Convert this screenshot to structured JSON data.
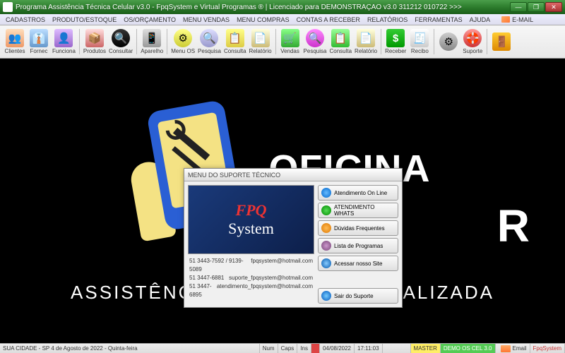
{
  "window": {
    "title": "Programa Assistência Técnica Celular v3.0 - FpqSystem e Virtual Programas ® | Licenciado para  DEMONSTRAÇÃO v3.0 311212 010722 >>>"
  },
  "menu": {
    "items": [
      "CADASTROS",
      "PRODUTO/ESTOQUE",
      "OS/ORÇAMENTO",
      "MENU VENDAS",
      "MENU COMPRAS",
      "CONTAS A RECEBER",
      "RELATÓRIOS",
      "FERRAMENTAS",
      "AJUDA"
    ],
    "email": "E-MAIL"
  },
  "toolbar": [
    {
      "id": "clientes",
      "label": "Clientes",
      "ico": "ico-clientes",
      "glyph": "👥"
    },
    {
      "id": "fornec",
      "label": "Fornec",
      "ico": "ico-fornec",
      "glyph": "👔"
    },
    {
      "id": "funciona",
      "label": "Funciona",
      "ico": "ico-funcion",
      "glyph": "👤"
    },
    {
      "sep": true
    },
    {
      "id": "produtos",
      "label": "Produtos",
      "ico": "ico-produtos",
      "glyph": "📦"
    },
    {
      "id": "consultar",
      "label": "Consultar",
      "ico": "ico-consultar",
      "glyph": "🔍"
    },
    {
      "sep": true
    },
    {
      "id": "aparelho",
      "label": "Aparelho",
      "ico": "ico-aparelho",
      "glyph": "📱"
    },
    {
      "sep": true
    },
    {
      "id": "menuos",
      "label": "Menu OS",
      "ico": "ico-menuos",
      "glyph": "⚙"
    },
    {
      "id": "pesquisa",
      "label": "Pesquisa",
      "ico": "ico-pesquisa",
      "glyph": "🔍"
    },
    {
      "id": "consulta",
      "label": "Consulta",
      "ico": "ico-consulta2",
      "glyph": "📋"
    },
    {
      "id": "relatorio",
      "label": "Relatório",
      "ico": "ico-relatorio",
      "glyph": "📄"
    },
    {
      "sep": true
    },
    {
      "id": "vendas",
      "label": "Vendas",
      "ico": "ico-vendas",
      "glyph": "🛒"
    },
    {
      "id": "pesquisa2",
      "label": "Pesquisa",
      "ico": "ico-pesquisa2",
      "glyph": "🔍"
    },
    {
      "id": "consulta2",
      "label": "Consulta",
      "ico": "ico-consulta3",
      "glyph": "📋"
    },
    {
      "id": "relatorio2",
      "label": "Relatório",
      "ico": "ico-relatorio2",
      "glyph": "📄"
    },
    {
      "sep": true
    },
    {
      "id": "receber",
      "label": "Receber",
      "ico": "ico-receber",
      "glyph": "$"
    },
    {
      "id": "recibo",
      "label": "Recibo",
      "ico": "ico-recibo",
      "glyph": "🧾"
    },
    {
      "sep": true
    },
    {
      "id": "ferram",
      "label": "",
      "ico": "ico-gear",
      "glyph": "⚙"
    },
    {
      "id": "suporte",
      "label": "Suporte",
      "ico": "ico-suporte",
      "glyph": "🛟"
    },
    {
      "sep": true
    },
    {
      "id": "sair",
      "label": "",
      "ico": "ico-exit",
      "glyph": "🚪"
    }
  ],
  "background": {
    "brand_top": "OFICINA",
    "brand_side": "R",
    "tagline": "ASSISTÊNCIA TÉCNICA ESPECIALIZADA"
  },
  "dialog": {
    "title": "MENU DO SUPORTE TÉCNICO",
    "logo_top": "FPQ",
    "logo_bottom": "System",
    "contacts": [
      {
        "phone": "51 3443-7592 / 9139-5089",
        "email": "fpqsystem@hotmail.com"
      },
      {
        "phone": "51 3447-6881",
        "email": "suporte_fpqsystem@hotmail.com"
      },
      {
        "phone": "51 3447-6895",
        "email": "atendimento_fpqsystem@hotmail.com"
      }
    ],
    "buttons": {
      "online": "Atendimento On Line",
      "whats": "ATENDIMENTO WHATS",
      "faq": "Dúvidas Frequentes",
      "programs": "Lista de Programas",
      "site": "Acessar nosso Site",
      "exit": "Sair do Suporte"
    }
  },
  "status": {
    "city_date": "SUA CIDADE - SP  4 de Agosto de 2022 - Quinta-feira",
    "num": "Num",
    "caps": "Caps",
    "ins": "Ins",
    "date": "04/08/2022",
    "time": "17:11:03",
    "master": "MASTER",
    "demo": "DEMO OS CEL 3.0",
    "email": "Email",
    "brand": "FpqSystem"
  }
}
